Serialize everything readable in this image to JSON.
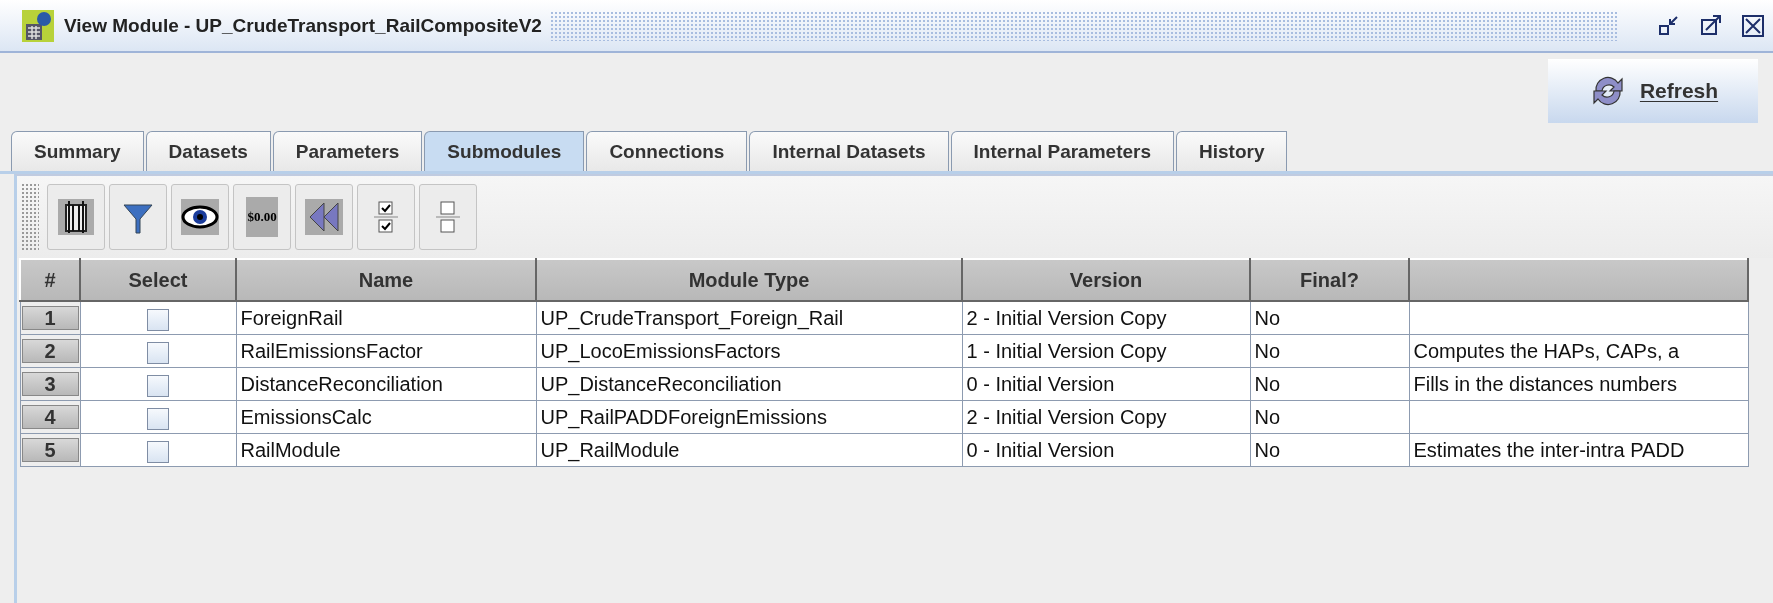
{
  "window": {
    "title": "View Module - UP_CrudeTransport_RailCompositeV2"
  },
  "refresh_button": {
    "label": "Refresh"
  },
  "tabs": [
    {
      "label": "Summary",
      "selected": false
    },
    {
      "label": "Datasets",
      "selected": false
    },
    {
      "label": "Parameters",
      "selected": false
    },
    {
      "label": "Submodules",
      "selected": true
    },
    {
      "label": "Connections",
      "selected": false
    },
    {
      "label": "Internal Datasets",
      "selected": false
    },
    {
      "label": "Internal Parameters",
      "selected": false
    },
    {
      "label": "History",
      "selected": false
    }
  ],
  "toolbar": [
    {
      "kind": "columns"
    },
    {
      "kind": "filter"
    },
    {
      "kind": "view"
    },
    {
      "kind": "format",
      "label": "$0.00"
    },
    {
      "kind": "reset"
    },
    {
      "kind": "select-all"
    },
    {
      "kind": "clear-all"
    }
  ],
  "table": {
    "columns": [
      "#",
      "Select",
      "Name",
      "Module Type",
      "Version",
      "Final?",
      ""
    ],
    "rows": [
      {
        "index": "1",
        "checked": false,
        "name": "ForeignRail",
        "module_type": "UP_CrudeTransport_Foreign_Rail",
        "version": "2 - Initial Version Copy",
        "final": "No"
      },
      {
        "index": "2",
        "checked": false,
        "name": "RailEmissionsFactor",
        "module_type": "UP_LocoEmissionsFactors",
        "version": "1 - Initial Version Copy",
        "final": "No",
        "column_7": "Computes the HAPs, CAPs, a"
      },
      {
        "index": "3",
        "checked": false,
        "name": "DistanceReconciliation",
        "module_type": "UP_DistanceReconciliation",
        "version": "0 - Initial Version",
        "final": "No",
        "column_7": "Fills in the distances numbers"
      },
      {
        "index": "4",
        "checked": false,
        "name": "EmissionsCalc",
        "module_type": "UP_RailPADDForeignEmissions",
        "version": "2 - Initial Version Copy",
        "final": "No"
      },
      {
        "index": "5",
        "checked": false,
        "name": "RailModule",
        "module_type": "UP_RailModule",
        "version": "0 - Initial Version",
        "final": "No",
        "column_7": "Estimates the inter-intra PADD"
      }
    ]
  }
}
